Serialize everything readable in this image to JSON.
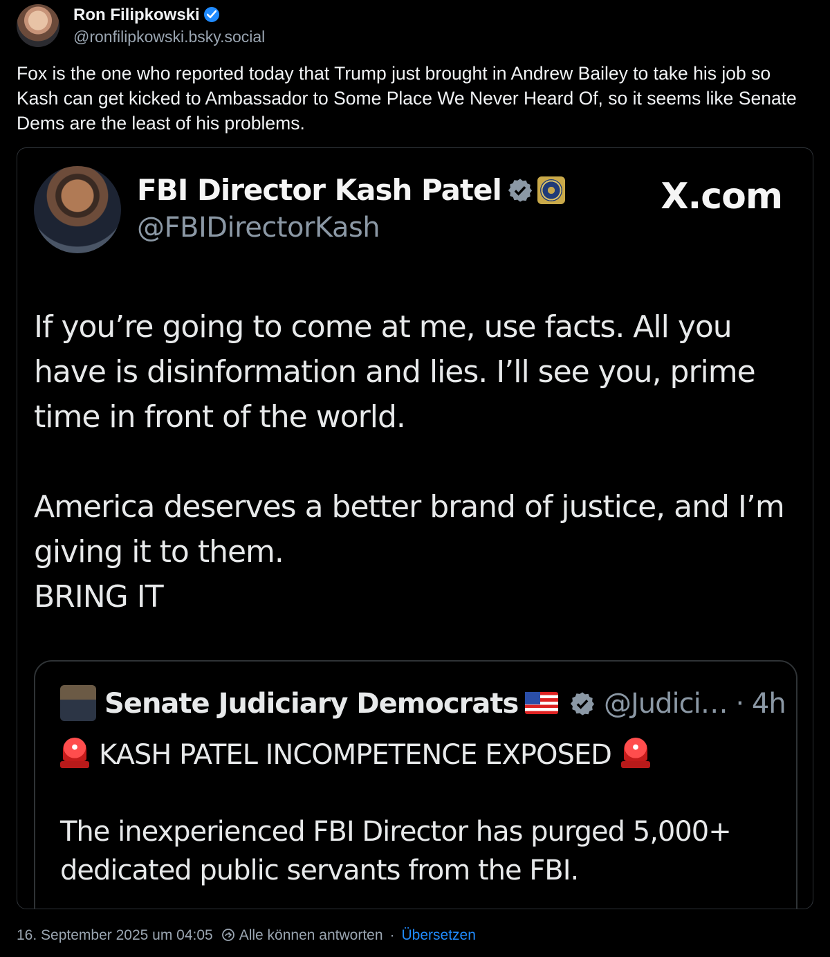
{
  "author": {
    "name": "Ron Filipkowski",
    "handle": "@ronfilipkowski.bsky.social"
  },
  "post_text": "Fox is the one who reported today that Trump just brought in Andrew Bailey to take his job so Kash can get kicked to Ambassador to Some Place We Never Heard Of, so it seems like Senate Dems are the least of his problems.",
  "embed": {
    "name": "FBI Director Kash Patel",
    "handle": "@FBIDirectorKash",
    "site": "X.com",
    "body_lines": [
      "If you’re going to come at me, use facts. All you have is disinformation and lies. I’ll see you, prime time in front of the world.",
      "America deserves a better brand of justice, and I’m giving it to them.",
      "BRING IT"
    ],
    "quote": {
      "name": "Senate Judiciary Democrats",
      "handle": "@Judici…",
      "time": "· 4h",
      "headline": "KASH PATEL INCOMPETENCE EXPOSED",
      "body": "The inexperienced FBI Director has purged 5,000+ dedicated public servants from the FBI."
    }
  },
  "meta": {
    "timestamp": "16. September 2025 um 04:05",
    "reply_setting": "Alle können antworten",
    "separator": "·",
    "translate": "Übersetzen"
  },
  "icons": {
    "verified": "verified-badge-icon",
    "reply": "reply-setting-icon",
    "siren": "siren-emoji-icon",
    "flag": "us-flag-emoji-icon"
  },
  "colors": {
    "background": "#000000",
    "text": "#f1f3f5",
    "muted": "#9aa5b1",
    "link": "#208bfe"
  }
}
